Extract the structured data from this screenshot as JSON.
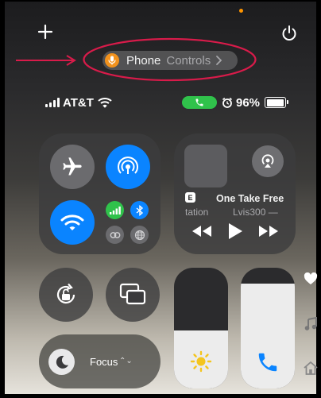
{
  "header": {
    "add_label": "+",
    "pill_primary": "Phone",
    "pill_secondary": "Controls",
    "indicator_color": "#ff9500",
    "annotation_color": "#d81b4a"
  },
  "status_bar": {
    "carrier": "AT&T",
    "battery_text": "96%",
    "battery_level": 0.96,
    "call_pill_color": "#30c24b"
  },
  "connectivity": {
    "airplane_mode": "off",
    "airdrop": "on",
    "wifi": "on",
    "cellular": "on",
    "bluetooth": "on",
    "icons": [
      "airplane-icon",
      "airdrop-icon",
      "wifi-icon",
      "cellular-icon",
      "bluetooth-icon",
      "link-icon",
      "globe-icon"
    ]
  },
  "media": {
    "source_badge": "E",
    "song_title": "One Take Free",
    "subtitle_left": "tation",
    "artist": "Lvis300 —"
  },
  "focus": {
    "label": "Focus",
    "chevron": "⌃⌄"
  },
  "sliders": {
    "brightness_level": 0.48,
    "volume_level": 0.87
  },
  "side_icons": [
    "heart-icon",
    "music-note-icon",
    "home-icon"
  ],
  "colors": {
    "accent_blue": "#0a84ff",
    "green": "#30c24b",
    "orange": "#f2921d",
    "sun_yellow": "#f4c51e",
    "phone_blue": "#0a84ff"
  }
}
